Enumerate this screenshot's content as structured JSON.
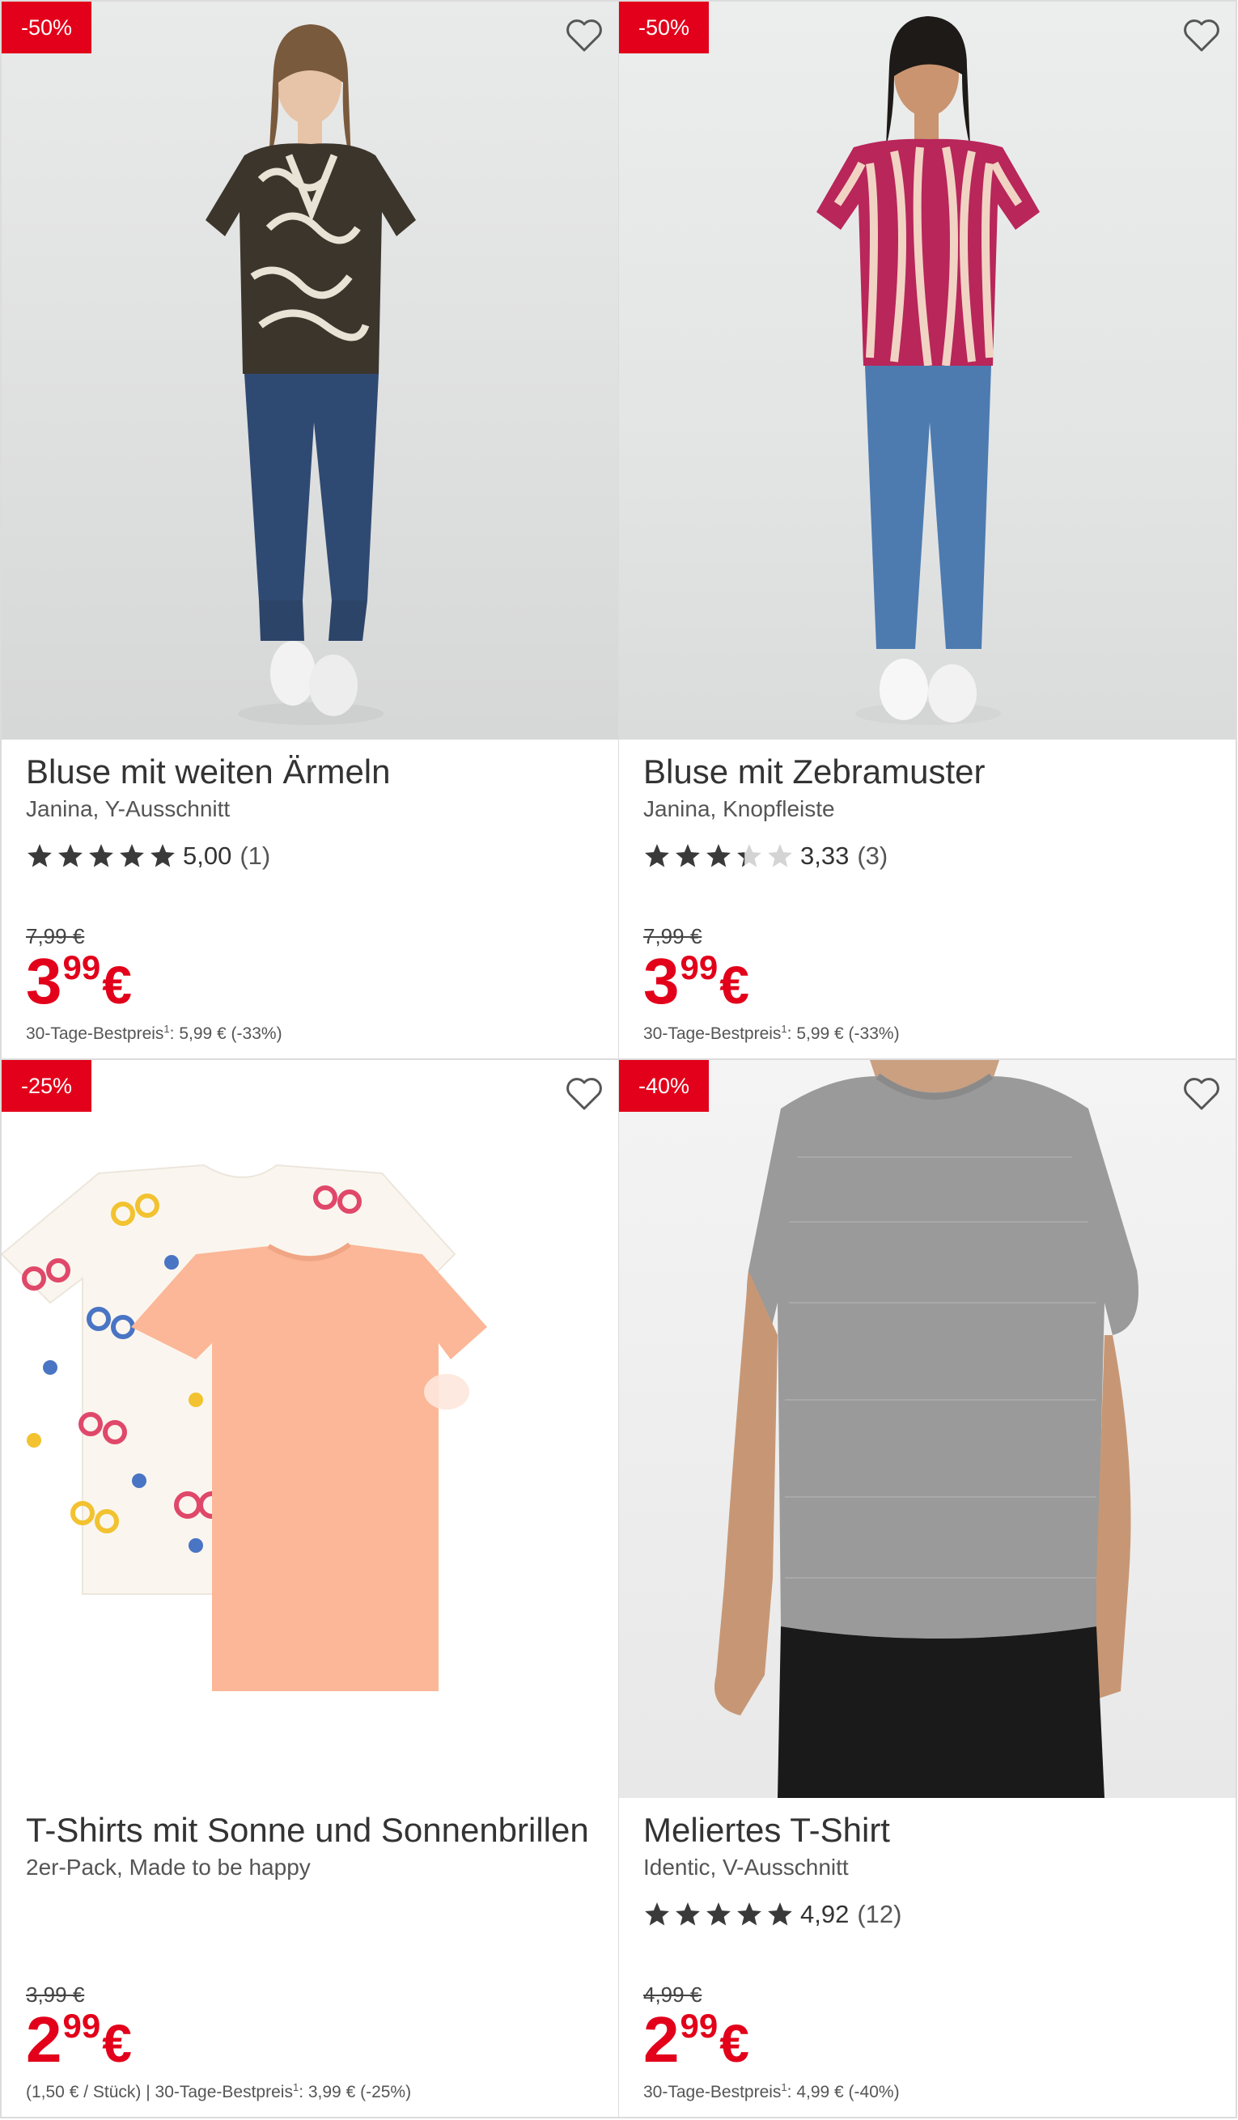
{
  "accent_color": "#e2001a",
  "products": [
    {
      "badge": "-50%",
      "title": "Bluse mit weiten Ärmeln",
      "subtitle": "Janina, Y-Ausschnitt",
      "rating": 5.0,
      "rating_text": "5,00",
      "rating_count": "(1)",
      "old_price": "7,99 €",
      "price_int": "3",
      "price_dec": "99",
      "currency": "€",
      "footnote_pre": "",
      "footnote_label": "30-Tage-Bestpreis",
      "footnote_sup": "1",
      "footnote_value": ": 5,99 € (-33%)",
      "image": "woman-patterned-blouse-photo",
      "favorite_icon": "heart-outline-icon"
    },
    {
      "badge": "-50%",
      "title": "Bluse mit Zebramuster",
      "subtitle": "Janina, Knopfleiste",
      "rating": 3.33,
      "rating_text": "3,33",
      "rating_count": "(3)",
      "old_price": "7,99 €",
      "price_int": "3",
      "price_dec": "99",
      "currency": "€",
      "footnote_pre": "",
      "footnote_label": "30-Tage-Bestpreis",
      "footnote_sup": "1",
      "footnote_value": ": 5,99 € (-33%)",
      "image": "woman-zebra-blouse-photo",
      "favorite_icon": "heart-outline-icon"
    },
    {
      "badge": "-25%",
      "title": "T-Shirts mit Sonne und Sonnenbrillen",
      "subtitle": "2er-Pack, Made to be happy",
      "old_price": "3,99 €",
      "price_int": "2",
      "price_dec": "99",
      "currency": "€",
      "footnote_pre": "(1,50 € / Stück)  |  ",
      "footnote_label": "30-Tage-Bestpreis",
      "footnote_sup": "1",
      "footnote_value": ": 3,99 € (-25%)",
      "image": "kids-tshirts-pack-photo",
      "favorite_icon": "heart-outline-icon"
    },
    {
      "badge": "-40%",
      "title": "Meliertes T-Shirt",
      "subtitle": "Identic, V-Ausschnitt",
      "rating": 4.92,
      "rating_text": "4,92",
      "rating_count": "(12)",
      "old_price": "4,99 €",
      "price_int": "2",
      "price_dec": "99",
      "currency": "€",
      "footnote_pre": "",
      "footnote_label": "30-Tage-Bestpreis",
      "footnote_sup": "1",
      "footnote_value": ": 4,99 € (-40%)",
      "image": "man-grey-tshirt-photo",
      "favorite_icon": "heart-outline-icon"
    }
  ]
}
